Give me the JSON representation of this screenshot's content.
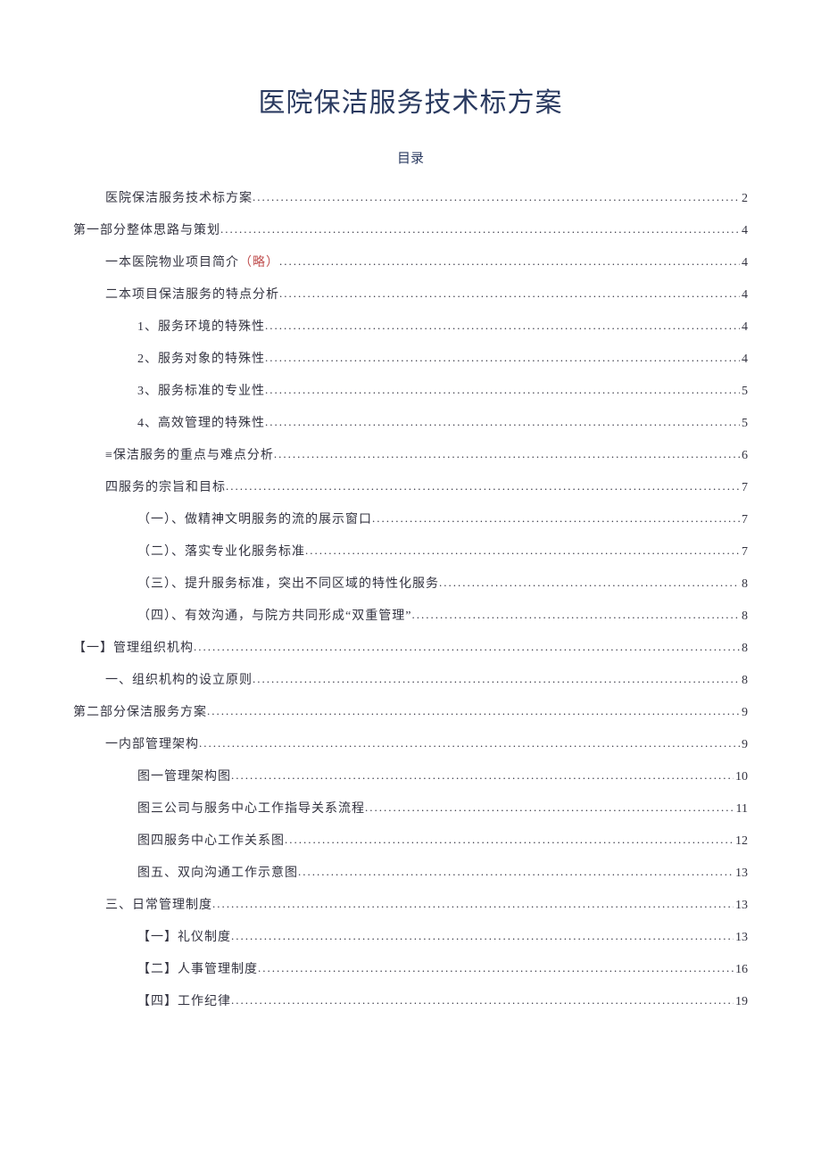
{
  "title": "医院保洁服务技术标方案",
  "toc_label": "目录",
  "toc": [
    {
      "level": 1,
      "text": "医院保洁服务技术标方案",
      "page": "2"
    },
    {
      "level": 0,
      "text": "第一部分整体思路与策划",
      "page": "4"
    },
    {
      "level": 1,
      "text": "一本医院物业项目简介",
      "note": "（略）",
      "page": "4"
    },
    {
      "level": 1,
      "text": "二本项目保洁服务的特点分析",
      "page": "4"
    },
    {
      "level": 2,
      "text": "1、服务环境的特殊性 ",
      "page": "4"
    },
    {
      "level": 2,
      "text": "2、服务对象的特殊性 ",
      "page": "4"
    },
    {
      "level": 2,
      "text": "3、服务标准的专业性 ",
      "page": "5"
    },
    {
      "level": 2,
      "text": "4、高效管理的特殊性 ",
      "page": "5"
    },
    {
      "level": 1,
      "text": "≡保洁服务的重点与难点分析",
      "page": "6"
    },
    {
      "level": 1,
      "text": "四服务的宗旨和目标",
      "page": "7"
    },
    {
      "level": 2,
      "text": "（一）、做精神文明服务的流的展示窗口 ",
      "page": "7"
    },
    {
      "level": 2,
      "text": "（二）、落实专业化服务标准 ",
      "page": "7"
    },
    {
      "level": 2,
      "text": "（三）、提升服务标准，突出不同区域的特性化服务 ",
      "page": "8"
    },
    {
      "level": 2,
      "text": "（四）、有效沟通，与院方共同形成“双重管理” ",
      "page": "8"
    },
    {
      "level": 0,
      "text": "【一】管理组织机构",
      "page": "8"
    },
    {
      "level": 1,
      "text": "一、组织机构的设立原则",
      "page": "8"
    },
    {
      "level": 0,
      "text": "第二部分保洁服务方案",
      "page": "9"
    },
    {
      "level": 1,
      "text": "一内部管理架构",
      "page": "9"
    },
    {
      "level": 2,
      "text": "图一管理架构图 ",
      "page": "10"
    },
    {
      "level": 2,
      "text": "图三公司与服务中心工作指导关系流程 ",
      "page": "11"
    },
    {
      "level": 2,
      "text": "图四服务中心工作关系图 ",
      "page": "12"
    },
    {
      "level": 2,
      "text": "图五、双向沟通工作示意图 ",
      "page": "13"
    },
    {
      "level": 1,
      "text": "三、日常管理制度",
      "page": "13"
    },
    {
      "level": 2,
      "text": "【一】礼仪制度 ",
      "page": "13"
    },
    {
      "level": 2,
      "text": "【二】人事管理制度 ",
      "page": "16"
    },
    {
      "level": 2,
      "text": "【四】工作纪律 ",
      "page": "19"
    }
  ]
}
